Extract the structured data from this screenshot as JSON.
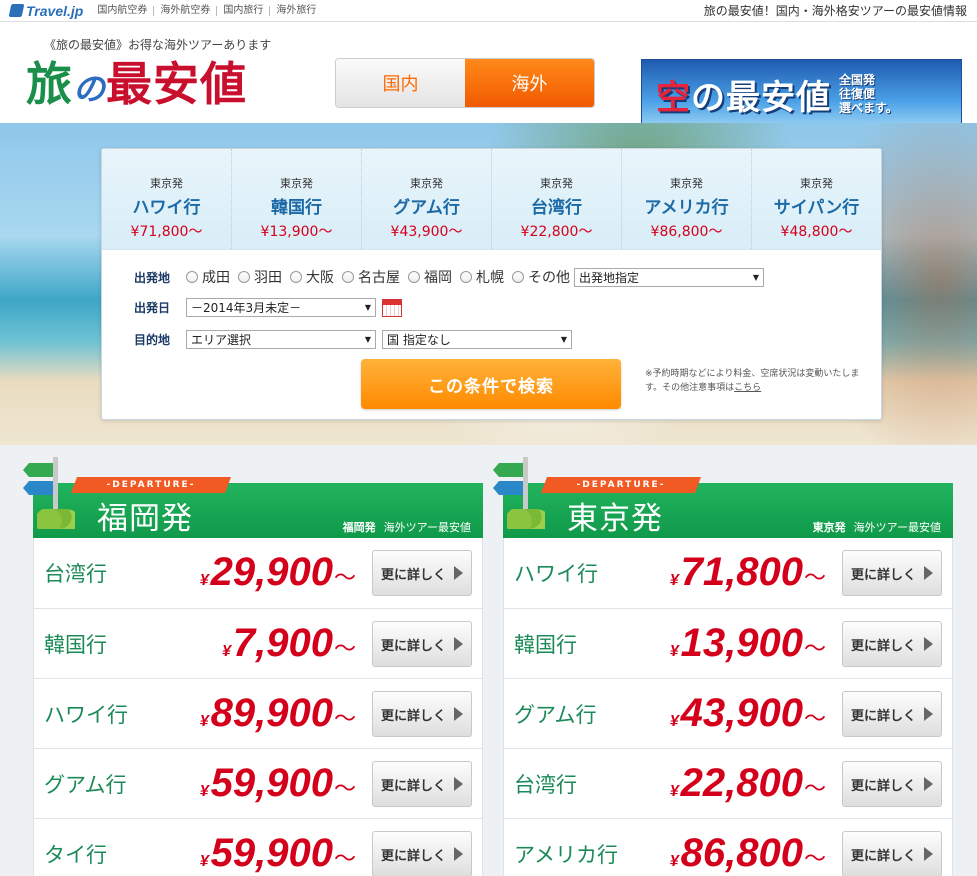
{
  "topbar": {
    "logo": "Travel.jp",
    "nav": [
      "国内航空券",
      "海外航空券",
      "国内旅行",
      "海外旅行"
    ],
    "right_text": "旅の最安値！国内・海外格安ツアーの最安値情報"
  },
  "header": {
    "tagline": "《旅の最安値》お得な海外ツアーあります",
    "brand_1": "旅",
    "brand_2": "の",
    "brand_3": "最安値",
    "toggle": {
      "domestic": "国内",
      "overseas": "海外",
      "active": "overseas"
    },
    "banner": {
      "title_1": "空",
      "title_2": "の最安値",
      "side_lines": [
        "全国発",
        "往復便",
        "選べます。"
      ]
    }
  },
  "search": {
    "destinations": [
      {
        "from": "東京発",
        "name": "ハワイ行",
        "price": "¥71,800〜"
      },
      {
        "from": "東京発",
        "name": "韓国行",
        "price": "¥13,900〜"
      },
      {
        "from": "東京発",
        "name": "グアム行",
        "price": "¥43,900〜"
      },
      {
        "from": "東京発",
        "name": "台湾行",
        "price": "¥22,800〜"
      },
      {
        "from": "東京発",
        "name": "アメリカ行",
        "price": "¥86,800〜"
      },
      {
        "from": "東京発",
        "name": "サイパン行",
        "price": "¥48,800〜"
      }
    ],
    "departure_label": "出発地",
    "departure_options": [
      "成田",
      "羽田",
      "大阪",
      "名古屋",
      "福岡",
      "札幌",
      "その他"
    ],
    "departure_select": "出発地指定",
    "date_label": "出発日",
    "date_select": "－2014年3月未定－",
    "dest_label": "目的地",
    "area_select": "エリア選択",
    "country_select": "国 指定なし",
    "search_button": "この条件で検索",
    "note": "※予約時期などにより料金、空席状況は変動いたします。その他注意事項は",
    "note_link": "こちら"
  },
  "panels": [
    {
      "tag": "DEPARTURE",
      "title": "福岡発",
      "sub_bold": "福岡発",
      "sub": "海外ツアー最安値",
      "rows": [
        {
          "dest": "台湾行",
          "yen": "¥",
          "price": "29,900",
          "tilde": "〜",
          "button": "更に詳しく"
        },
        {
          "dest": "韓国行",
          "yen": "¥",
          "price": "7,900",
          "tilde": "〜",
          "button": "更に詳しく"
        },
        {
          "dest": "ハワイ行",
          "yen": "¥",
          "price": "89,900",
          "tilde": "〜",
          "button": "更に詳しく"
        },
        {
          "dest": "グアム行",
          "yen": "¥",
          "price": "59,900",
          "tilde": "〜",
          "button": "更に詳しく"
        },
        {
          "dest": "タイ行",
          "yen": "¥",
          "price": "59,900",
          "tilde": "〜",
          "button": "更に詳しく"
        }
      ]
    },
    {
      "tag": "DEPARTURE",
      "title": "東京発",
      "sub_bold": "東京発",
      "sub": "海外ツアー最安値",
      "rows": [
        {
          "dest": "ハワイ行",
          "yen": "¥",
          "price": "71,800",
          "tilde": "〜",
          "button": "更に詳しく"
        },
        {
          "dest": "韓国行",
          "yen": "¥",
          "price": "13,900",
          "tilde": "〜",
          "button": "更に詳しく"
        },
        {
          "dest": "グアム行",
          "yen": "¥",
          "price": "43,900",
          "tilde": "〜",
          "button": "更に詳しく"
        },
        {
          "dest": "台湾行",
          "yen": "¥",
          "price": "22,800",
          "tilde": "〜",
          "button": "更に詳しく"
        },
        {
          "dest": "アメリカ行",
          "yen": "¥",
          "price": "86,800",
          "tilde": "〜",
          "button": "更に詳しく"
        }
      ]
    }
  ],
  "colors": {
    "accent_orange": "#ff7a00",
    "price_red": "#d4001b",
    "panel_green": "#14a650",
    "link_blue": "#1b6aa7"
  }
}
